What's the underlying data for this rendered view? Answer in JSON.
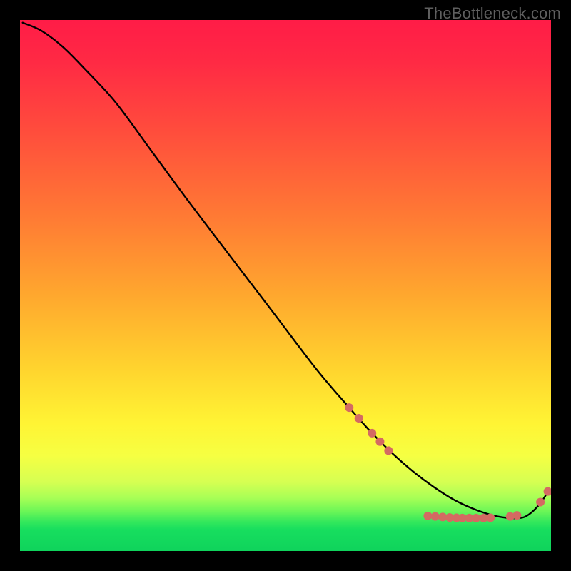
{
  "attribution": "TheBottleneck.com",
  "chart_data": {
    "type": "line",
    "title": "",
    "xlabel": "",
    "ylabel": "",
    "xlim": [
      0,
      100
    ],
    "ylim": [
      0,
      100
    ],
    "grid": false,
    "legend": false,
    "notes": "Axes are unlabeled in the image; x and y are normalized 0–100 to the plot area. The curve descends from top-left, flattens near the bottom-right, and rises slightly at the far right. Salmon dots mark sampled points along the lower-right portion of the curve.",
    "series": [
      {
        "name": "curve",
        "color": "#000000",
        "x": [
          0.5,
          4,
          8,
          12,
          18,
          25,
          32,
          40,
          48,
          56,
          62,
          66,
          70,
          74,
          78,
          82,
          86,
          90,
          94,
          96,
          98,
          99.5
        ],
        "y": [
          99.5,
          98,
          95,
          91,
          84.5,
          75,
          65.5,
          55,
          44.5,
          34,
          27,
          22.5,
          18.5,
          15,
          12,
          9.5,
          7.7,
          6.5,
          6.2,
          7,
          9,
          11.3
        ]
      }
    ],
    "markers": {
      "name": "dots",
      "color": "#d46a62",
      "radius": 6,
      "points": [
        {
          "x": 62.0,
          "y": 27.0
        },
        {
          "x": 63.8,
          "y": 25.0
        },
        {
          "x": 66.3,
          "y": 22.2
        },
        {
          "x": 67.8,
          "y": 20.6
        },
        {
          "x": 69.4,
          "y": 18.9
        },
        {
          "x": 76.8,
          "y": 6.6
        },
        {
          "x": 78.2,
          "y": 6.5
        },
        {
          "x": 79.6,
          "y": 6.4
        },
        {
          "x": 80.9,
          "y": 6.3
        },
        {
          "x": 82.2,
          "y": 6.25
        },
        {
          "x": 83.3,
          "y": 6.2
        },
        {
          "x": 84.6,
          "y": 6.2
        },
        {
          "x": 85.9,
          "y": 6.2
        },
        {
          "x": 87.3,
          "y": 6.2
        },
        {
          "x": 88.6,
          "y": 6.25
        },
        {
          "x": 92.3,
          "y": 6.5
        },
        {
          "x": 93.6,
          "y": 6.7
        },
        {
          "x": 98.0,
          "y": 9.2
        },
        {
          "x": 99.4,
          "y": 11.2
        }
      ]
    }
  }
}
